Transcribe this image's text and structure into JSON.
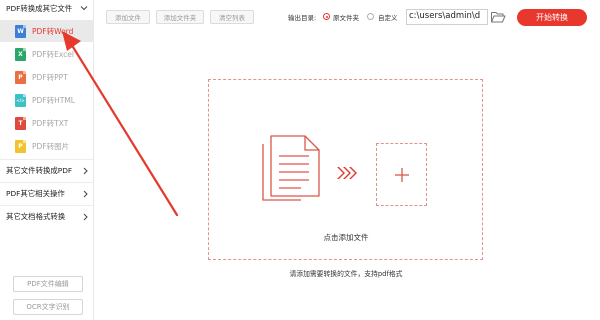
{
  "colors": {
    "accent": "#e23a2f",
    "start_button": "#e8372c",
    "dashed_border": "#e2938d"
  },
  "sidebar": {
    "header": {
      "label": "PDF转换成其它文件",
      "icon": "chevron-down-icon"
    },
    "items": [
      {
        "label": "PDF转Word",
        "badge": "W",
        "badge_color": "#3f7fd8",
        "active": true
      },
      {
        "label": "PDF转Excel",
        "badge": "X",
        "badge_color": "#2aa86a",
        "active": false
      },
      {
        "label": "PDF转PPT",
        "badge": "P",
        "badge_color": "#e9703f",
        "active": false
      },
      {
        "label": "PDF转HTML",
        "badge": "</>",
        "badge_color": "#3cc1c5",
        "active": false
      },
      {
        "label": "PDF转TXT",
        "badge": "T",
        "badge_color": "#dd4a3e",
        "active": false
      },
      {
        "label": "PDF转图片",
        "badge": "P",
        "badge_color": "#f2c32c",
        "active": false
      }
    ],
    "groups": [
      {
        "label": "其它文件转换成PDF",
        "icon": "chevron-right-icon"
      },
      {
        "label": "PDF其它相关操作",
        "icon": "chevron-right-icon"
      },
      {
        "label": "其它文档格式转换",
        "icon": "chevron-right-icon"
      }
    ],
    "bottom_buttons": [
      "PDF文件编辑",
      "OCR文字识别"
    ]
  },
  "toolbar": {
    "add_file": "添加文件",
    "add_folder": "添加文件夹",
    "clear_list": "清空列表",
    "output_label": "输出目录:",
    "option_source": "原文件夹",
    "option_custom": "自定义",
    "path_value": "c:\\users\\admin\\d",
    "folder_icon": "folder-open-icon",
    "start_label": "开始转换"
  },
  "drop_zone": {
    "label": "点击添加文件",
    "hint": "请添加需要转换的文件，支持pdf格式",
    "icons": [
      "document-stack-icon",
      "triple-arrow-right-icon",
      "plus-icon"
    ]
  }
}
